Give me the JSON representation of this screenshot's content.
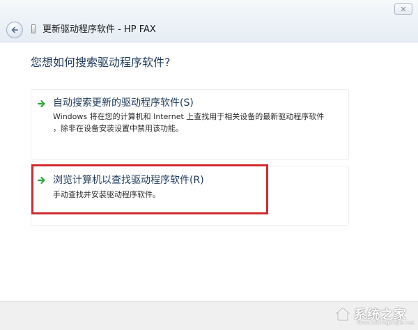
{
  "window": {
    "title": "更新驱动程序软件 - HP FAX",
    "close_glyph": "✕"
  },
  "icons": {
    "back": "back-arrow-icon",
    "device": "device-icon",
    "option_arrow": "green-arrow-icon"
  },
  "prompt": {
    "question": "您想如何搜索驱动程序软件?"
  },
  "options": [
    {
      "title": "自动搜索更新的驱动程序软件(S)",
      "description_line1": "Windows 将在您的计算机和 Internet 上查找用于相关设备的最新驱动程序软件",
      "description_line2": "，除非在设备安装设置中禁用该功能。"
    },
    {
      "title": "浏览计算机以查找驱动程序软件(R)",
      "description_line1": "手动查找并安装驱动程序软件。"
    }
  ],
  "watermark": {
    "text": "系统之家",
    "url": "www.xitongzhijia.net"
  },
  "colors": {
    "heading": "#1e395b",
    "arrow": "#2fa83a",
    "highlight": "#d22a2e",
    "footer": "#f0f0f0"
  }
}
